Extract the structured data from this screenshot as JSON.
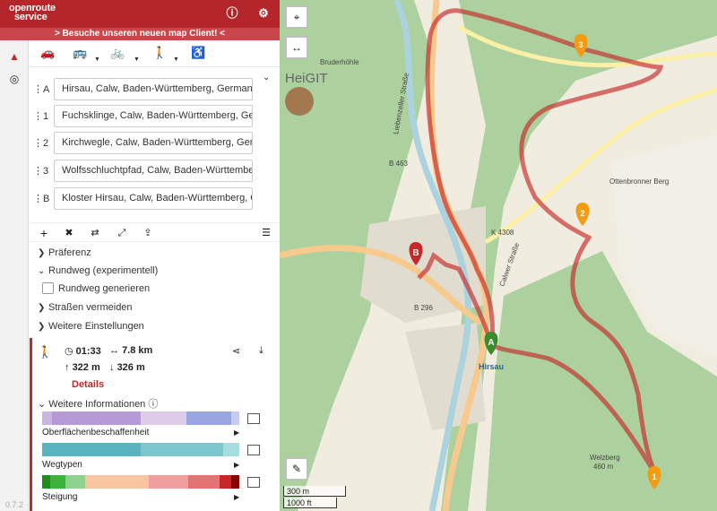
{
  "header": {
    "logo_line1": "openroute",
    "logo_line2": "service",
    "info_icon": "info-icon",
    "settings_icon": "gear-icon"
  },
  "banner": "> Besuche unseren neuen map Client! <",
  "modes": [
    "car-icon",
    "truck-icon",
    "bike-icon",
    "walk-icon",
    "wheelchair-icon"
  ],
  "waypoints": [
    {
      "index": "A",
      "value": "Hirsau, Calw, Baden-Württemberg, Germany"
    },
    {
      "index": "1",
      "value": "Fuchsklinge, Calw, Baden-Württemberg, Germany"
    },
    {
      "index": "2",
      "value": "Kirchwegle, Calw, Baden-Württemberg, Germany"
    },
    {
      "index": "3",
      "value": "Wolfsschluchtpfad, Calw, Baden-Württemberg, Germany"
    },
    {
      "index": "B",
      "value": "Kloster Hirsau, Calw, Baden-Württemberg, Germany"
    }
  ],
  "options": {
    "preference": "Präferenz",
    "roundtrip": "Rundweg (experimentell)",
    "roundtrip_generate": "Rundweg generieren",
    "avoid_streets": "Straßen vermeiden",
    "more_settings": "Weitere Einstellungen"
  },
  "route": {
    "duration": "01:33",
    "distance": "7.8 km",
    "ascent": "322 m",
    "descent": "326 m",
    "details_label": "Details",
    "more_info": "Weitere Informationen"
  },
  "extras": [
    {
      "label": "Oberflächenbeschaffenheit",
      "segments": [
        {
          "w": 0.05,
          "c": "#c9b6df"
        },
        {
          "w": 0.45,
          "c": "#b59ad6"
        },
        {
          "w": 0.23,
          "c": "#dccbe9"
        },
        {
          "w": 0.23,
          "c": "#9aa6e0"
        },
        {
          "w": 0.04,
          "c": "#c4cdf0"
        }
      ]
    },
    {
      "label": "Wegtypen",
      "segments": [
        {
          "w": 0.5,
          "c": "#5bb3bf"
        },
        {
          "w": 0.42,
          "c": "#7dc6ce"
        },
        {
          "w": 0.08,
          "c": "#a6dde1"
        }
      ]
    },
    {
      "label": "Steigung",
      "segments": [
        {
          "w": 0.04,
          "c": "#1a8f1a"
        },
        {
          "w": 0.08,
          "c": "#3cb13c"
        },
        {
          "w": 0.1,
          "c": "#8fd18f"
        },
        {
          "w": 0.32,
          "c": "#f7c6a1"
        },
        {
          "w": 0.2,
          "c": "#ef9f9f"
        },
        {
          "w": 0.16,
          "c": "#e57373"
        },
        {
          "w": 0.06,
          "c": "#c62828"
        },
        {
          "w": 0.04,
          "c": "#8b0000"
        }
      ]
    }
  ],
  "version": "0.7.2",
  "map": {
    "labels": [
      "HeiGIT",
      "Bruderhöhle",
      "Liebenzeller Straße",
      "B 463",
      "B 296",
      "K 4308",
      "Hirsau",
      "Ottenbronner Berg",
      "Welzberg",
      "460 m",
      "Calwer Straße"
    ],
    "markers": [
      {
        "label": "A",
        "color": "#3d8b2f"
      },
      {
        "label": "B",
        "color": "#c62828"
      },
      {
        "label": "1",
        "color": "#f39c12"
      },
      {
        "label": "2",
        "color": "#f39c12"
      },
      {
        "label": "3",
        "color": "#f39c12"
      }
    ],
    "scale_m": "300 m",
    "scale_ft": "1000 ft"
  },
  "colors": {
    "brand": "#b5262a",
    "route": "#c62828"
  }
}
